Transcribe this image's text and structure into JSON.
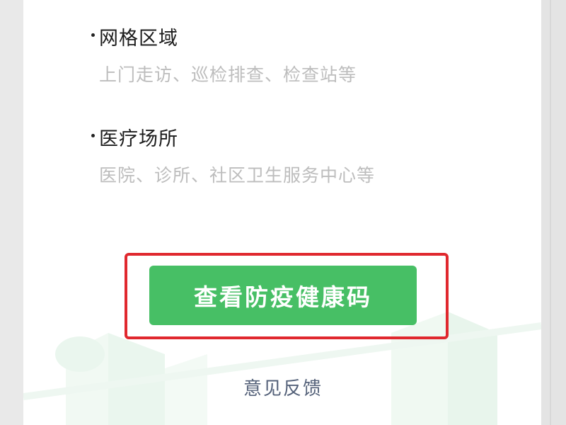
{
  "scenes": [
    {
      "title": "网格区域",
      "description": "上门走访、巡检排查、检查站等"
    },
    {
      "title": "医疗场所",
      "description": "医院、诊所、社区卫生服务中心等"
    }
  ],
  "actions": {
    "primary_label": "查看防疫健康码",
    "feedback_label": "意见反馈"
  },
  "colors": {
    "primary_green": "#47bf65",
    "highlight_red": "#e0282e",
    "feedback_text": "#55627a"
  }
}
